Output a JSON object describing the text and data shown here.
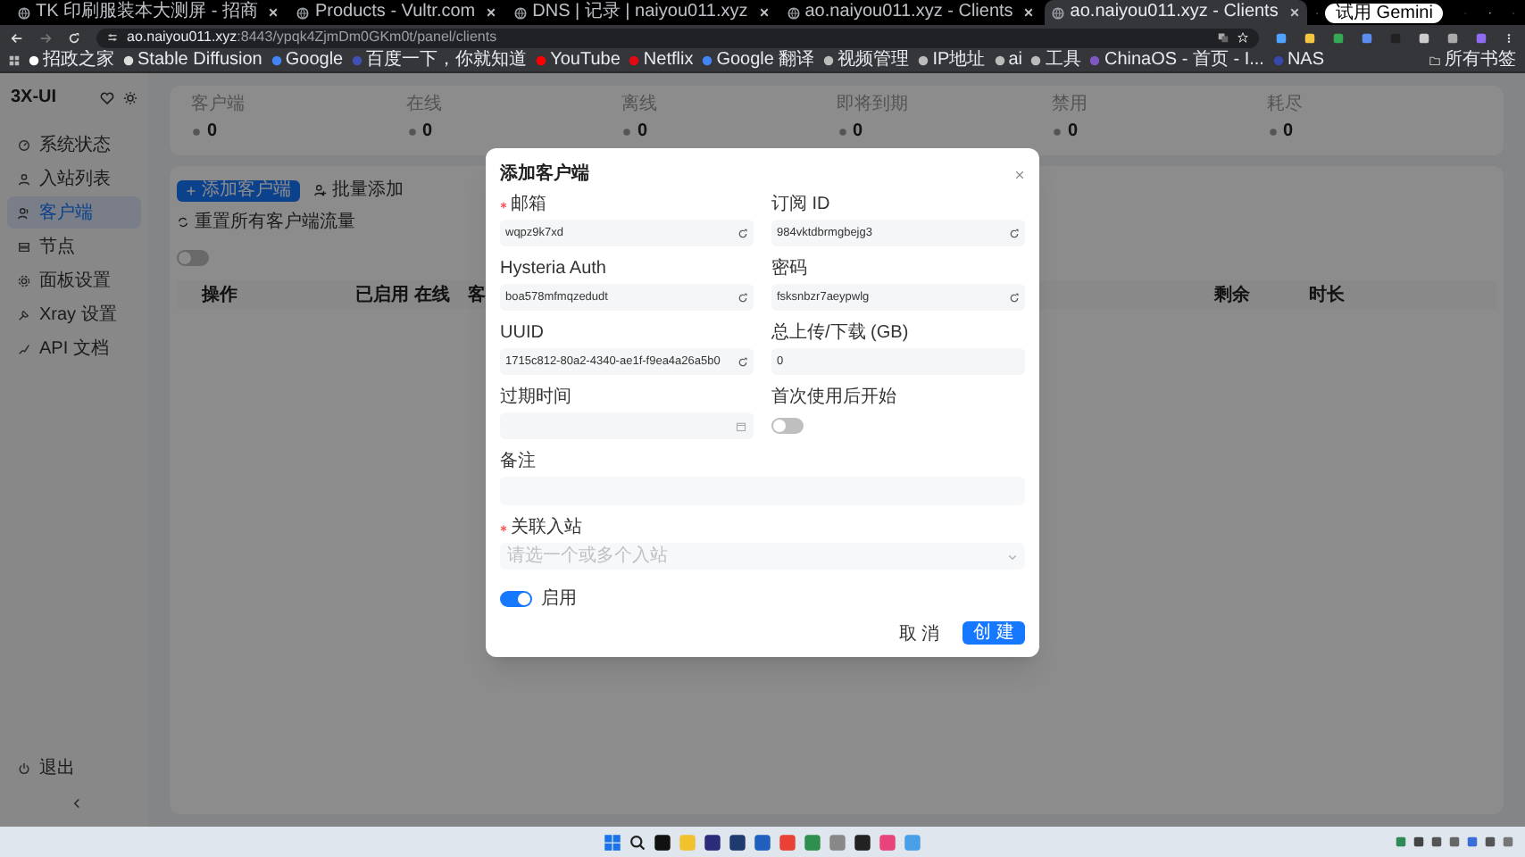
{
  "browser": {
    "tabs": [
      {
        "title": "TK 印刷服装本大测屏 - 招商",
        "selected": false
      },
      {
        "title": "Products - Vultr.com",
        "selected": false
      },
      {
        "title": "DNS | 记录 | naiyou011.xyz",
        "selected": false
      },
      {
        "title": "ao.naiyou011.xyz - Clients",
        "selected": false
      },
      {
        "title": "ao.naiyou011.xyz - Clients",
        "selected": true
      }
    ],
    "gemini_button": "试用 Gemini",
    "address": {
      "host": "ao.naiyou011.xyz",
      "path": ":8443/ypqk4ZjmDm0GKm0t/panel/clients"
    },
    "bookmarks": [
      "招政之家",
      "Stable Diffusion",
      "Google",
      "百度一下，你就知道",
      "YouTube",
      "Netflix",
      "Google 翻译",
      "视频管理",
      "IP地址",
      "ai",
      "工具",
      "ChinaOS - 首页 - I...",
      "NAS"
    ],
    "all_bookmarks": "所有书签"
  },
  "sidebar": {
    "brand": "3X-UI",
    "items": [
      {
        "label": "系统状态",
        "selected": false
      },
      {
        "label": "入站列表",
        "selected": false
      },
      {
        "label": "客户端",
        "selected": true
      },
      {
        "label": "节点",
        "selected": false
      },
      {
        "label": "面板设置",
        "selected": false
      },
      {
        "label": "Xray 设置",
        "selected": false
      },
      {
        "label": "API 文档",
        "selected": false
      }
    ],
    "logout": "退出"
  },
  "stats": [
    {
      "label": "客户端",
      "value": "0"
    },
    {
      "label": "在线",
      "value": "0"
    },
    {
      "label": "离线",
      "value": "0"
    },
    {
      "label": "即将到期",
      "value": "0"
    },
    {
      "label": "禁用",
      "value": "0"
    },
    {
      "label": "耗尽",
      "value": "0"
    }
  ],
  "toolbar": {
    "add_button": "添加客户端",
    "actions": [
      "批量添加",
      "重置所有客户端流量"
    ]
  },
  "filter_switch": {
    "on": false
  },
  "table": {
    "columns": [
      "操作",
      "已启用",
      "在线",
      "客",
      "剩余",
      "时长"
    ]
  },
  "dialog": {
    "title": "添加客户端",
    "fields": [
      {
        "kind": "input",
        "label": "邮箱",
        "required": true,
        "value": "wqpz9k7xd",
        "refresh": true
      },
      {
        "kind": "input",
        "label": "订阅 ID",
        "required": false,
        "value": "984vktdbrmgbejg3",
        "refresh": true
      },
      {
        "kind": "input",
        "label": "Hysteria Auth",
        "required": false,
        "value": "boa578mfmqzedudt",
        "refresh": true
      },
      {
        "kind": "input",
        "label": "密码",
        "required": false,
        "value": "fsksnbzr7aeypwlg",
        "refresh": true
      },
      {
        "kind": "input",
        "label": "UUID",
        "required": false,
        "value": "1715c812-80a2-4340-ae1f-f9ea4a26a5b0",
        "refresh": true
      },
      {
        "kind": "input",
        "label": "总上传/下载 (GB)",
        "required": false,
        "value": "0",
        "refresh": false
      },
      {
        "kind": "date",
        "label": "过期时间",
        "required": false
      },
      {
        "kind": "switch",
        "label": "首次使用后开始",
        "required": false,
        "on": false
      },
      {
        "kind": "textarea",
        "label": "备注",
        "required": false,
        "wide": true
      },
      {
        "kind": "select",
        "label": "关联入站",
        "required": true,
        "placeholder": "请选一个或多个入站",
        "wide": true
      }
    ],
    "enable_switch": {
      "label": "启用",
      "on": true
    },
    "cancel_button": "取 消",
    "create_button": "创 建"
  }
}
